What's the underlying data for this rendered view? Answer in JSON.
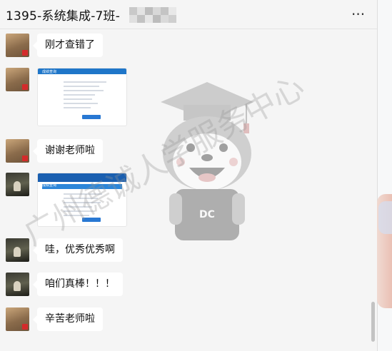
{
  "window": {
    "title": "1395-系统集成-7班-"
  },
  "icons": {
    "more": "more-options-icon"
  },
  "messages": [
    {
      "id": "m1",
      "sender": "user-a",
      "type": "text",
      "text": "刚才查错了"
    },
    {
      "id": "m2",
      "sender": "user-a",
      "type": "image",
      "caption": "成绩查询"
    },
    {
      "id": "m3",
      "sender": "user-a",
      "type": "text",
      "text": "谢谢老师啦"
    },
    {
      "id": "m4",
      "sender": "user-b",
      "type": "image",
      "caption": "成绩查询"
    },
    {
      "id": "m5",
      "sender": "user-b",
      "type": "text",
      "text": "哇，优秀优秀啊"
    },
    {
      "id": "m6",
      "sender": "user-b",
      "type": "text",
      "text": "咱们真棒！！！"
    },
    {
      "id": "m7",
      "sender": "user-a",
      "type": "text",
      "text": "辛苦老师啦"
    }
  ],
  "watermark": {
    "text": "广州德诚人学服务中心",
    "badge": "DC"
  },
  "colors": {
    "chat_bg": "#f5f5f5",
    "bubble": "#ffffff",
    "accent": "#1f76c9"
  }
}
